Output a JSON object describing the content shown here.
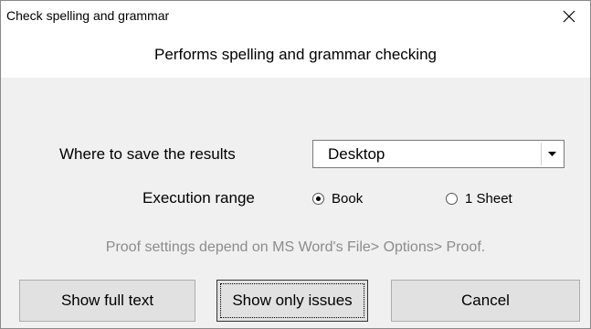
{
  "window": {
    "title": "Check spelling and grammar"
  },
  "description": "Performs spelling and grammar checking",
  "save_location": {
    "label": "Where to save the results",
    "selected": "Desktop"
  },
  "execution_range": {
    "label": "Execution range",
    "options": [
      {
        "label": "Book",
        "checked": true
      },
      {
        "label": "1 Sheet",
        "checked": false
      }
    ]
  },
  "note": "Proof settings depend on MS Word's File> Options> Proof.",
  "buttons": {
    "show_full_text": "Show full text",
    "show_only_issues": "Show only issues",
    "cancel": "Cancel"
  }
}
